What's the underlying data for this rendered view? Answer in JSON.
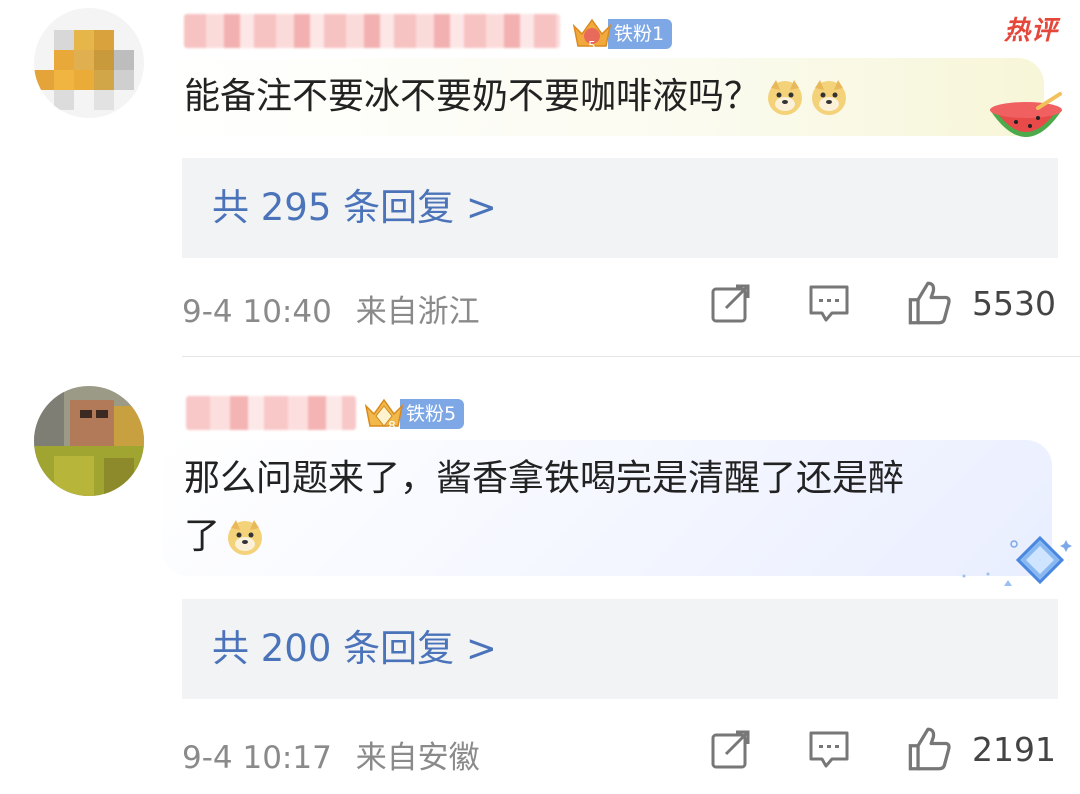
{
  "comments": [
    {
      "fan_badge": "铁粉1",
      "crown_level": "5",
      "hot_label": "热评",
      "text": "能备注不要冰不要奶不要咖啡液吗？",
      "replies": "共 295 条回复 >",
      "date": "9-4 10:40",
      "location": "来自浙江",
      "likes": "5530"
    },
    {
      "fan_badge": "铁粉5",
      "crown_level": "8",
      "text_line1": "那么问题来了，酱香拿铁喝完是清醒了还是醉",
      "text_line2": "了",
      "replies": "共 200 条回复 >",
      "date": "9-4 10:17",
      "location": "来自安徽",
      "likes": "2191"
    }
  ],
  "colors": {
    "link_blue": "#4a73b9",
    "badge_blue": "#7ea7e6",
    "hot_red": "#e5473a",
    "meta_gray": "#8a8a8a",
    "reply_bg": "#f2f3f5"
  },
  "icons": [
    "repost-icon",
    "comment-icon",
    "like-icon",
    "doge-emoji",
    "watermelon-sticker",
    "crystal-sticker"
  ]
}
